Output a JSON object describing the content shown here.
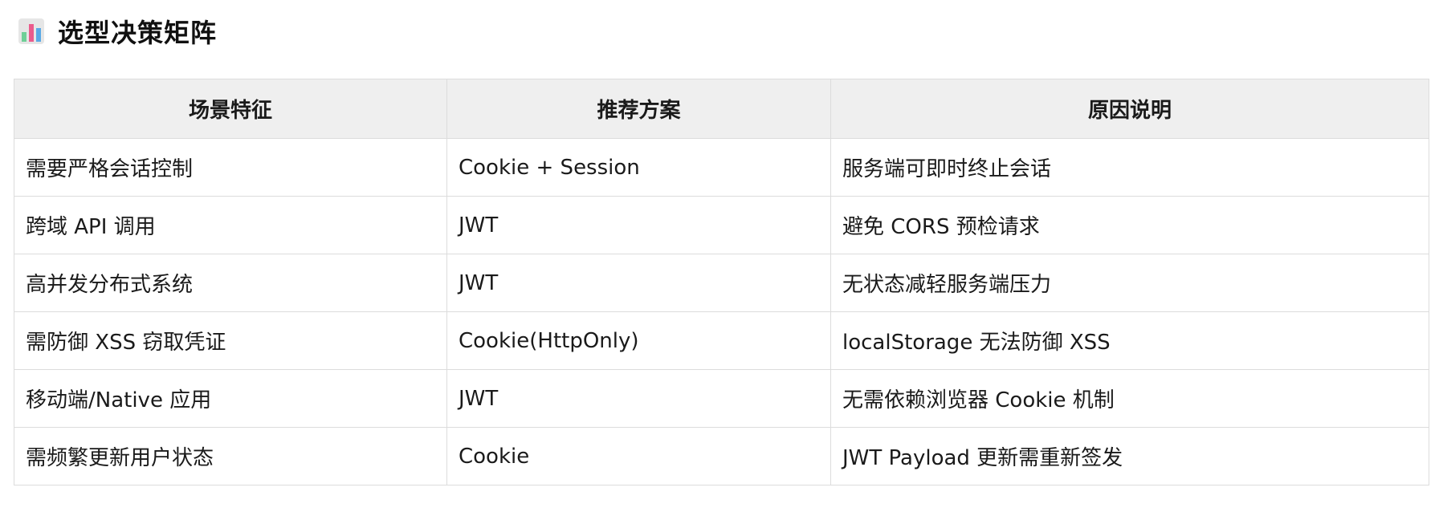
{
  "heading": {
    "icon": "bar-chart-icon",
    "title": "选型决策矩阵"
  },
  "table": {
    "headers": [
      "场景特征",
      "推荐方案",
      "原因说明"
    ],
    "rows": [
      [
        "需要严格会话控制",
        "Cookie + Session",
        "服务端可即时终止会话"
      ],
      [
        "跨域 API 调用",
        "JWT",
        "避免 CORS 预检请求"
      ],
      [
        "高并发分布式系统",
        "JWT",
        "无状态减轻服务端压力"
      ],
      [
        "需防御 XSS 窃取凭证",
        "Cookie(HttpOnly)",
        "localStorage 无法防御 XSS"
      ],
      [
        "移动端/Native 应用",
        "JWT",
        "无需依赖浏览器 Cookie 机制"
      ],
      [
        "需频繁更新用户状态",
        "Cookie",
        "JWT Payload 更新需重新签发"
      ]
    ]
  },
  "colors": {
    "icon_bars": [
      "#6fcf97",
      "#eb5b8c",
      "#5aa9e6"
    ],
    "icon_bg": "#e6e6e6",
    "header_bg": "#efefef",
    "border": "#dcdcdc"
  }
}
